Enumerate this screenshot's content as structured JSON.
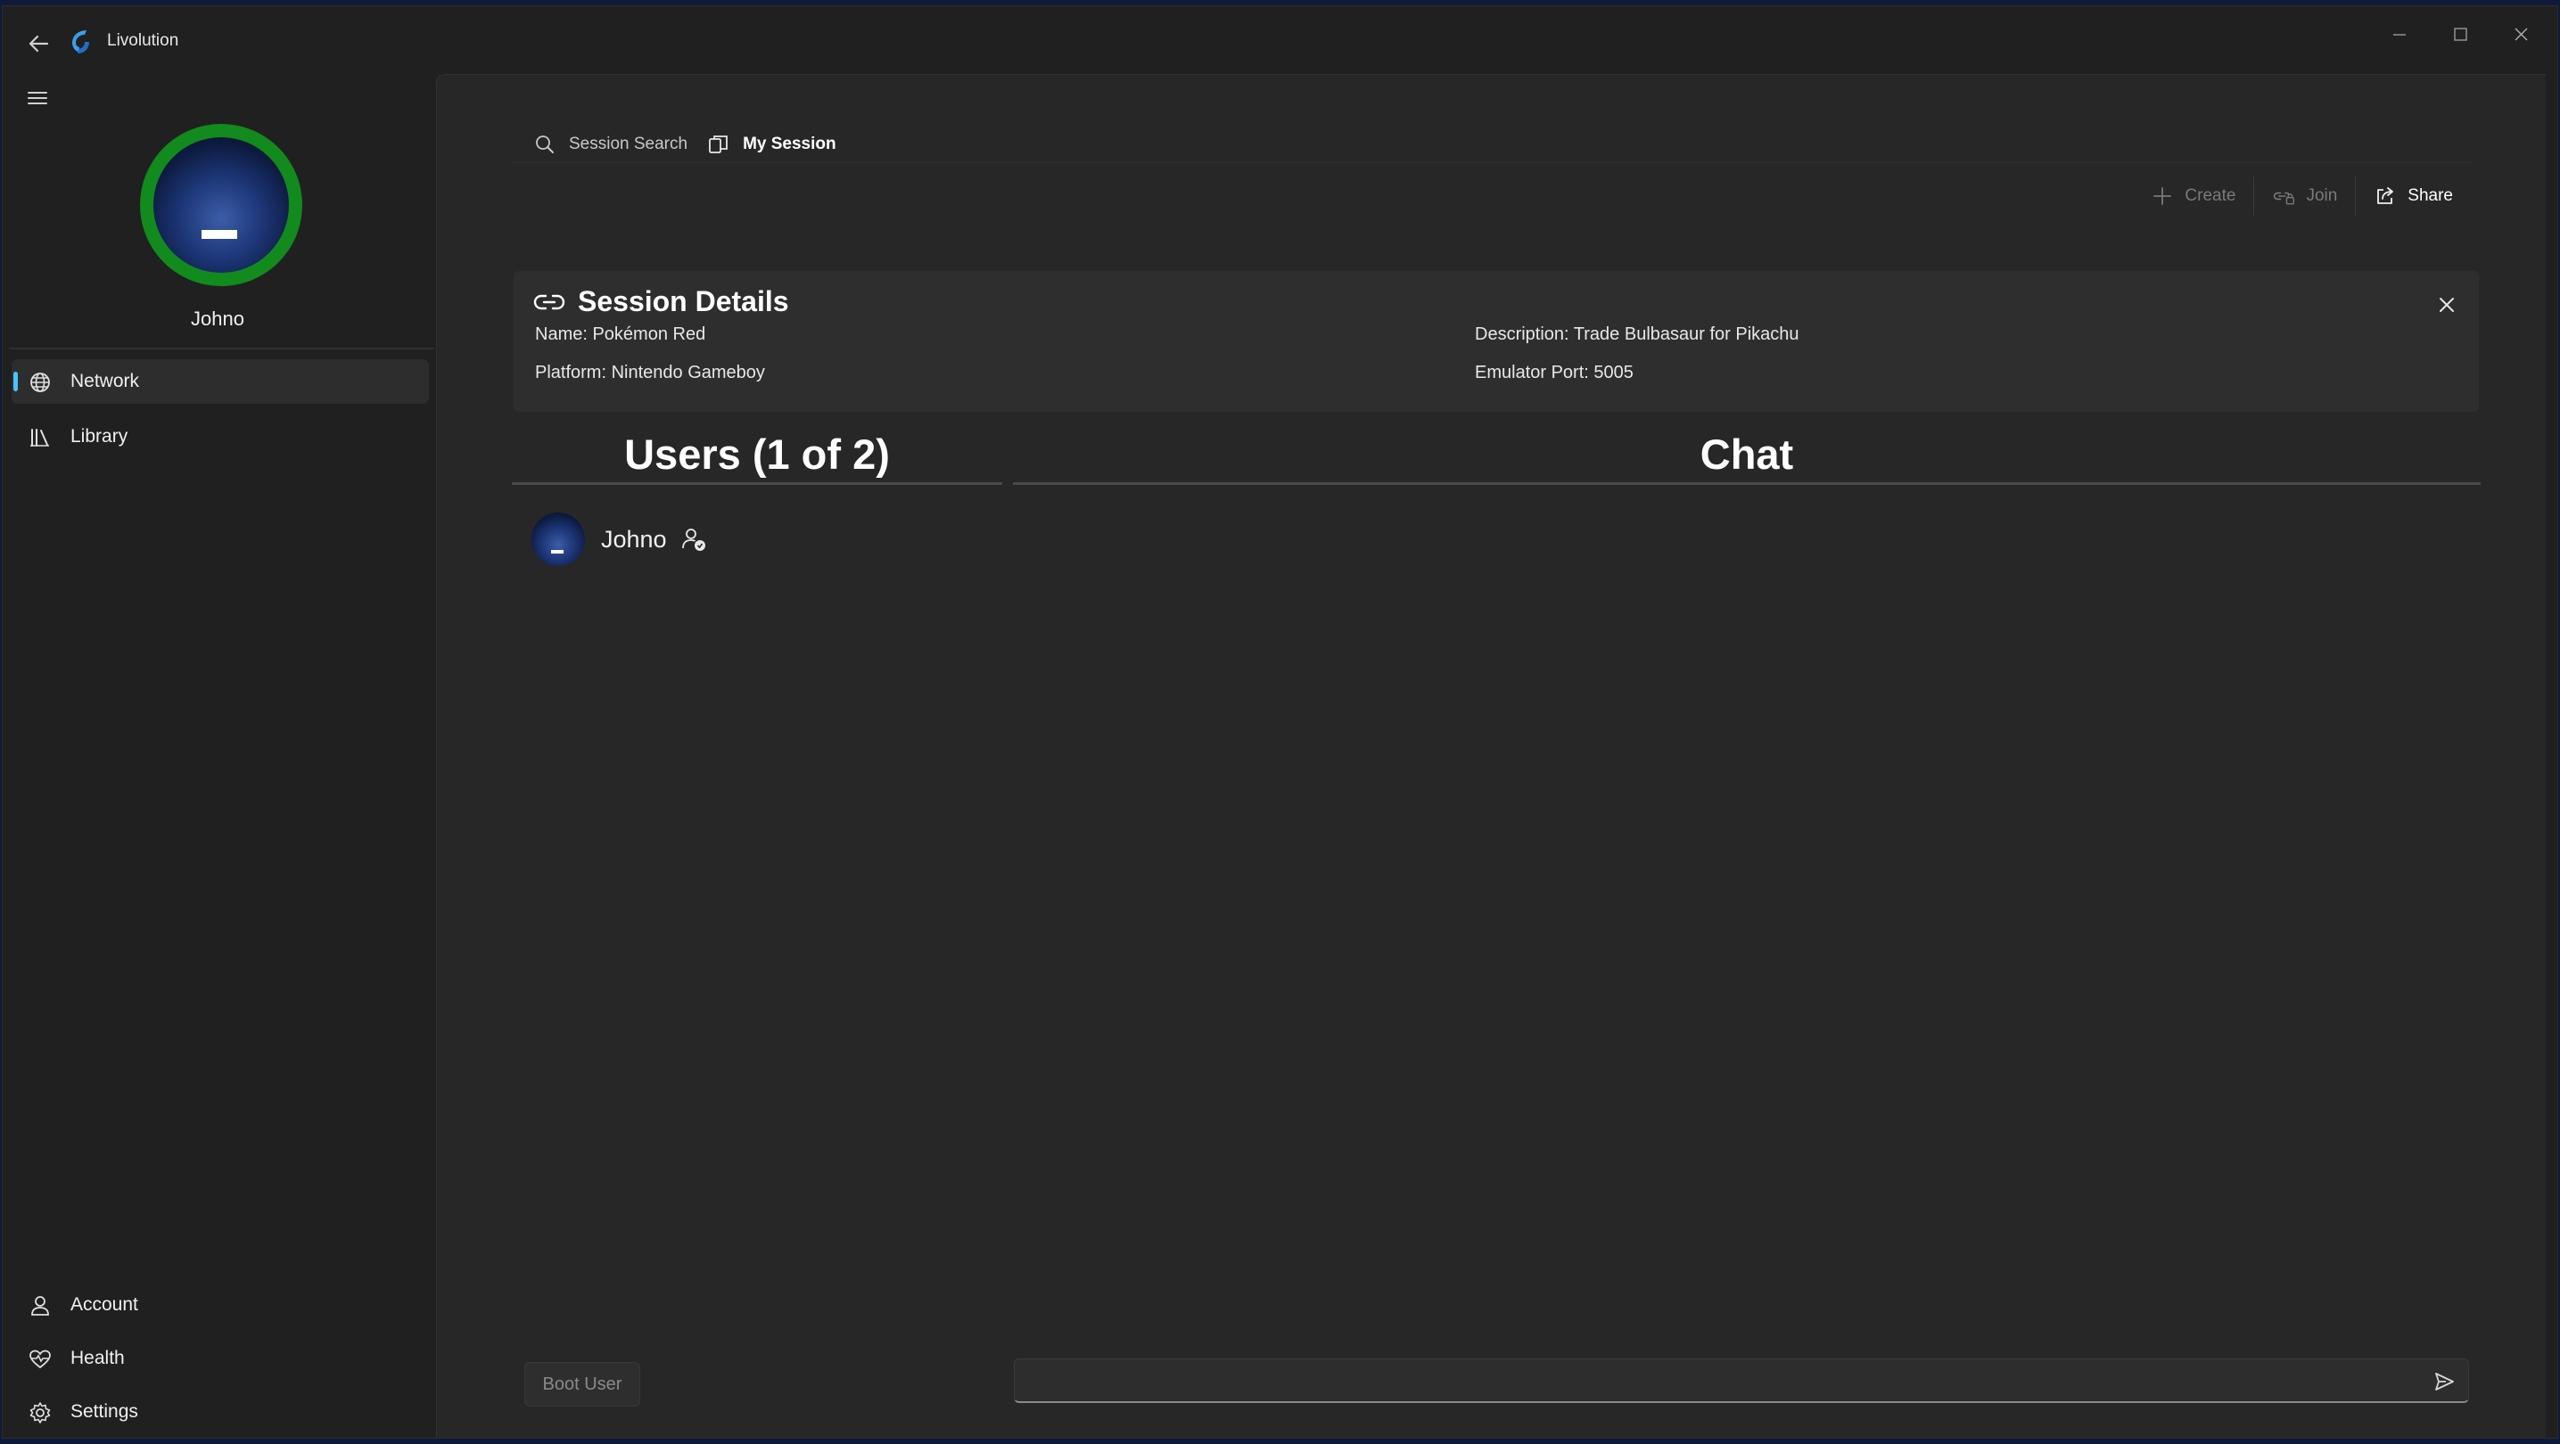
{
  "window": {
    "title": "Livolution",
    "icons": {
      "back": "back-arrow-icon",
      "logo": "app-logo-icon",
      "minimize": "minimize-icon",
      "maximize": "maximize-icon",
      "close": "close-icon"
    }
  },
  "sidebar": {
    "menu_icon": "hamburger-icon",
    "user_name": "Johno",
    "profile_ring_color": "#128a1d",
    "top_items": [
      {
        "label": "Network",
        "icon": "globe-icon",
        "selected": true
      },
      {
        "label": "Library",
        "icon": "library-icon",
        "selected": false
      }
    ],
    "bottom_items": [
      {
        "label": "Account",
        "icon": "person-icon"
      },
      {
        "label": "Health",
        "icon": "heart-pulse-icon"
      },
      {
        "label": "Settings",
        "icon": "gear-icon"
      }
    ]
  },
  "tabs": [
    {
      "label": "Session Search",
      "icon": "search-icon",
      "active": false
    },
    {
      "label": "My Session",
      "icon": "session-icon",
      "active": true
    }
  ],
  "commands": {
    "create": {
      "label": "Create",
      "enabled": false,
      "icon": "plus-icon"
    },
    "join": {
      "label": "Join",
      "enabled": false,
      "icon": "link-lock-icon"
    },
    "share": {
      "label": "Share",
      "enabled": true,
      "icon": "share-icon"
    }
  },
  "session_details": {
    "title": "Session Details",
    "name": "Name: Pokémon Red",
    "platform": "Platform: Nintendo Gameboy",
    "description": "Description: Trade Bulbasaur for Pikachu",
    "emulator_port": "Emulator Port: 5005"
  },
  "users_section": {
    "header": "Users (1 of 2)",
    "users": [
      {
        "name": "Johno",
        "is_host": true
      }
    ]
  },
  "chat_section": {
    "header": "Chat",
    "input_value": "",
    "send_icon": "send-icon"
  },
  "footer": {
    "boot_user_label": "Boot User"
  },
  "colors": {
    "accent": "#4cc2ff",
    "background": "#202020",
    "content": "#272727"
  }
}
